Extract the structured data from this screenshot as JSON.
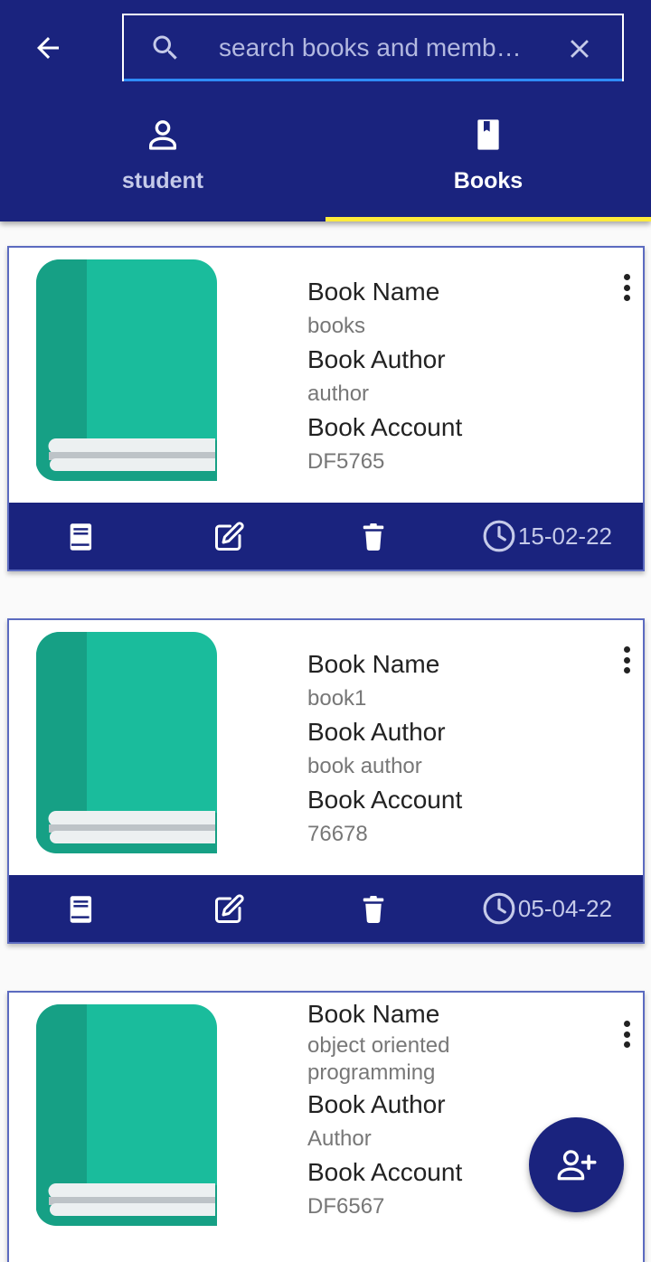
{
  "search": {
    "placeholder": "search books and memb…"
  },
  "tabs": [
    {
      "label": "student",
      "icon": "person-icon",
      "active": false
    },
    {
      "label": "Books",
      "icon": "book-icon",
      "active": true
    }
  ],
  "labels": {
    "book_name": "Book Name",
    "book_author": "Book Author",
    "book_account": "Book Account"
  },
  "books": [
    {
      "name": "books",
      "author": "author",
      "account": "DF5765",
      "date": "15-02-22"
    },
    {
      "name": "book1",
      "author": "book author",
      "account": "76678",
      "date": "05-04-22"
    },
    {
      "name": "object oriented programming",
      "author": "Author",
      "account": "DF6567",
      "date": ""
    }
  ],
  "colors": {
    "primary": "#1a237e",
    "tab_indicator": "#ffeb3b",
    "search_underline": "#2f8cff",
    "book_cover": "#1abc9c",
    "card_border": "#5c6bc0"
  },
  "icons": {
    "back": "arrow-left-icon",
    "search": "search-icon",
    "clear": "close-icon",
    "more": "more-vert-icon",
    "view": "book-icon",
    "edit": "edit-icon",
    "delete": "trash-icon",
    "date": "clock-icon",
    "fab": "add-person-icon"
  }
}
